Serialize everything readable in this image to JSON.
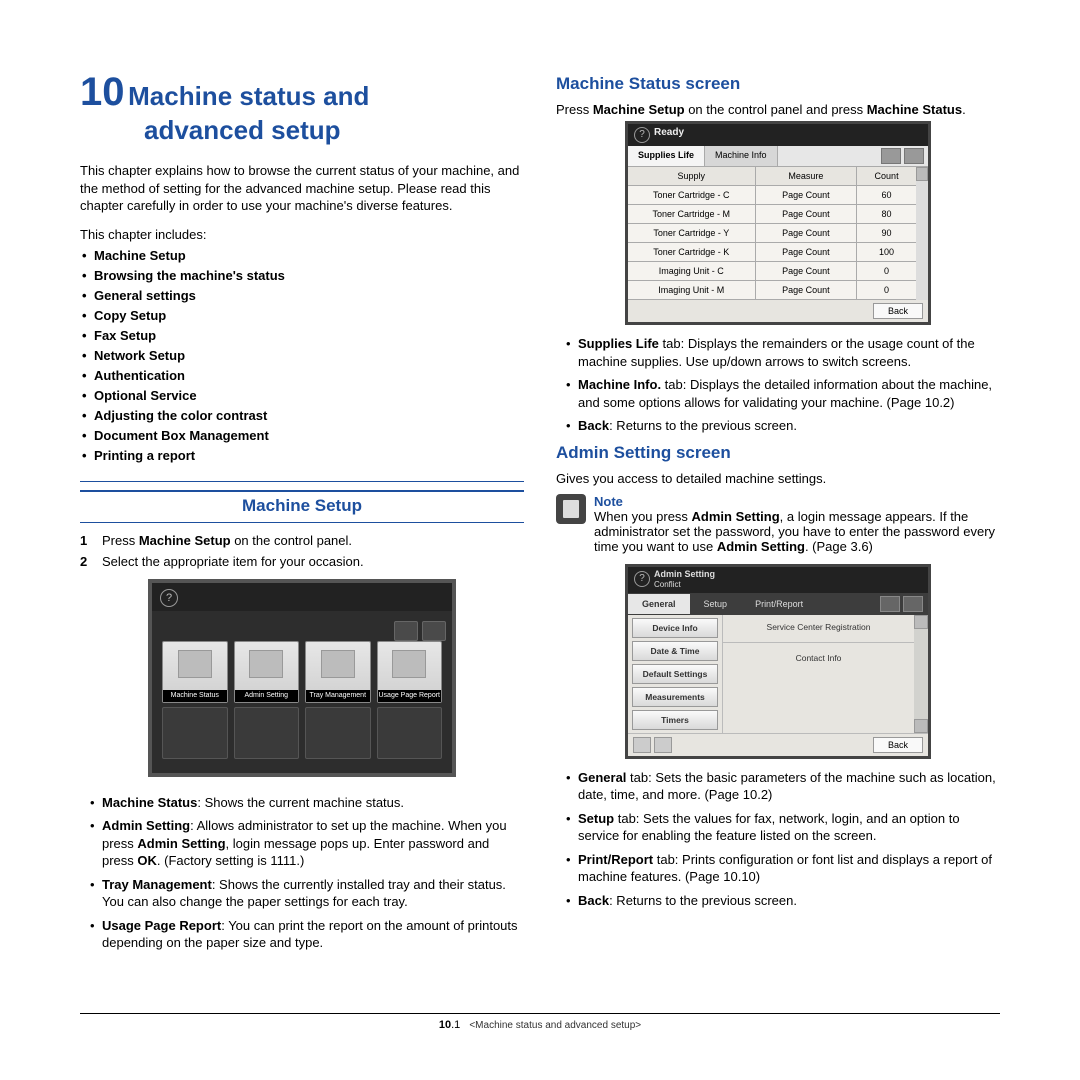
{
  "left": {
    "ch_num": "10",
    "ch_name_l1": "Machine status and",
    "ch_name_l2": "advanced setup",
    "intro": "This chapter explains how to browse the current status of your machine, and the method of setting for the advanced machine setup. Please read this chapter carefully in order to use your machine's diverse features.",
    "toc_label": "This chapter includes:",
    "toc": [
      "Machine Setup",
      "Browsing the machine's status",
      "General settings",
      "Copy Setup",
      "Fax Setup",
      "Network Setup",
      "Authentication",
      "Optional Service",
      "Adjusting the color contrast",
      "Document Box Management",
      "Printing a report"
    ],
    "h2": "Machine Setup",
    "steps": [
      {
        "n": "1",
        "pre": "Press ",
        "b1": "Machine Setup",
        "post": " on the control panel."
      },
      {
        "n": "2",
        "pre": "Select the appropriate item for your occasion.",
        "b1": "",
        "post": ""
      }
    ],
    "ms_tiles": [
      "Machine Status",
      "Admin Setting",
      "Tray Management",
      "Usage Page Report"
    ],
    "bullets": [
      {
        "b": "Machine Status",
        "t": ": Shows the current machine status."
      },
      {
        "b": "Admin Setting",
        "t_pre": ": Allows administrator to set up the machine. When you press ",
        "b2": "Admin Setting",
        "t_mid": ", login message pops up. Enter password and press ",
        "b3": "OK",
        "t_post": ". (Factory setting is 1111.)"
      },
      {
        "b": "Tray Management",
        "t": ": Shows the currently installed tray and their status. You can also change the paper settings for each tray."
      },
      {
        "b": "Usage Page Report",
        "t": ": You can print the report on the amount of printouts depending on the paper size and type."
      }
    ]
  },
  "right": {
    "h3a": "Machine Status screen",
    "p1_pre": "Press ",
    "p1_b1": "Machine Setup",
    "p1_mid": " on the control panel and press ",
    "p1_b2": "Machine Status",
    "p1_post": ".",
    "st": {
      "ready": "Ready",
      "tab1": "Supplies Life",
      "tab2": "Machine Info",
      "hd": [
        "Supply",
        "Measure",
        "Count"
      ],
      "rows": [
        [
          "Toner Cartridge - C",
          "Page Count",
          "60"
        ],
        [
          "Toner Cartridge - M",
          "Page Count",
          "80"
        ],
        [
          "Toner Cartridge - Y",
          "Page Count",
          "90"
        ],
        [
          "Toner Cartridge - K",
          "Page Count",
          "100"
        ],
        [
          "Imaging Unit - C",
          "Page Count",
          "0"
        ],
        [
          "Imaging Unit - M",
          "Page Count",
          "0"
        ]
      ],
      "back": "Back"
    },
    "st_bul": [
      {
        "b": "Supplies Life",
        "t": " tab: Displays the remainders or the usage count of the machine supplies. Use up/down arrows to switch screens."
      },
      {
        "b": "Machine Info.",
        "t": " tab: Displays the detailed information about the machine, and some options allows for validating your machine. (Page 10.2)"
      },
      {
        "b": "Back",
        "t": ": Returns to the previous screen."
      }
    ],
    "h3b": "Admin Setting screen",
    "p2": "Gives you access to detailed machine settings.",
    "note_title": "Note",
    "note_pre": "When you press ",
    "note_b1": "Admin Setting",
    "note_mid": ", a login message appears. If the administrator set the password, you have to enter the password every time you want to use ",
    "note_b2": "Admin Setting",
    "note_post": ". (Page 3.6)",
    "ad": {
      "t1": "Admin Setting",
      "t2": "Conflict",
      "tabs": [
        "General",
        "Setup",
        "Print/Report"
      ],
      "side": [
        "Device Info",
        "Date & Time",
        "Default Settings",
        "Measurements",
        "Timers"
      ],
      "items": [
        "Service Center Registration",
        "Contact Info"
      ],
      "back": "Back"
    },
    "ad_bul": [
      {
        "b": "General",
        "t": " tab: Sets the basic parameters of the machine such as location, date, time, and more. (Page 10.2)"
      },
      {
        "b": "Setup",
        "t": " tab: Sets the values for fax, network, login, and an option to service for enabling the feature listed on the screen."
      },
      {
        "b": "Print/Report",
        "t": " tab: Prints configuration or font list and displays a report of machine features. (Page 10.10)"
      },
      {
        "b": "Back",
        "t": ": Returns to the previous screen."
      }
    ]
  },
  "footer": {
    "page_b": "10",
    "page_n": ".1",
    "title": "<Machine status and advanced setup>"
  }
}
